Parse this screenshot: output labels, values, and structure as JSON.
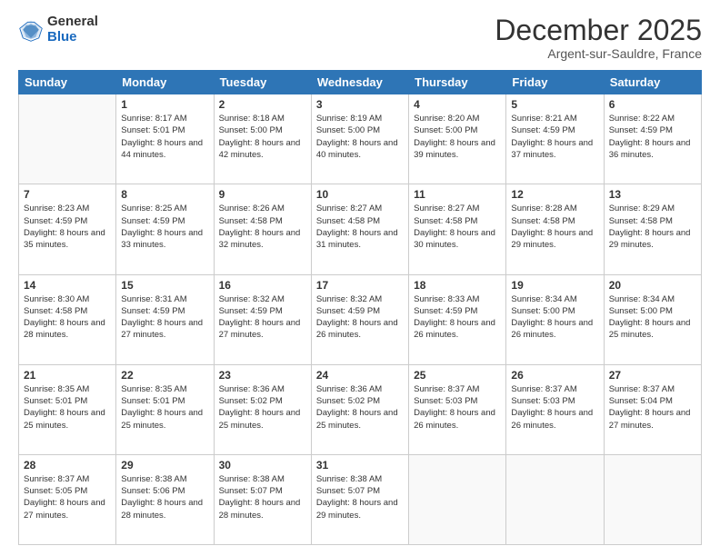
{
  "header": {
    "logo_general": "General",
    "logo_blue": "Blue",
    "month_title": "December 2025",
    "location": "Argent-sur-Sauldre, France"
  },
  "weekdays": [
    "Sunday",
    "Monday",
    "Tuesday",
    "Wednesday",
    "Thursday",
    "Friday",
    "Saturday"
  ],
  "weeks": [
    [
      {
        "day": "",
        "sunrise": "",
        "sunset": "",
        "daylight": ""
      },
      {
        "day": "1",
        "sunrise": "Sunrise: 8:17 AM",
        "sunset": "Sunset: 5:01 PM",
        "daylight": "Daylight: 8 hours and 44 minutes."
      },
      {
        "day": "2",
        "sunrise": "Sunrise: 8:18 AM",
        "sunset": "Sunset: 5:00 PM",
        "daylight": "Daylight: 8 hours and 42 minutes."
      },
      {
        "day": "3",
        "sunrise": "Sunrise: 8:19 AM",
        "sunset": "Sunset: 5:00 PM",
        "daylight": "Daylight: 8 hours and 40 minutes."
      },
      {
        "day": "4",
        "sunrise": "Sunrise: 8:20 AM",
        "sunset": "Sunset: 5:00 PM",
        "daylight": "Daylight: 8 hours and 39 minutes."
      },
      {
        "day": "5",
        "sunrise": "Sunrise: 8:21 AM",
        "sunset": "Sunset: 4:59 PM",
        "daylight": "Daylight: 8 hours and 37 minutes."
      },
      {
        "day": "6",
        "sunrise": "Sunrise: 8:22 AM",
        "sunset": "Sunset: 4:59 PM",
        "daylight": "Daylight: 8 hours and 36 minutes."
      }
    ],
    [
      {
        "day": "7",
        "sunrise": "Sunrise: 8:23 AM",
        "sunset": "Sunset: 4:59 PM",
        "daylight": "Daylight: 8 hours and 35 minutes."
      },
      {
        "day": "8",
        "sunrise": "Sunrise: 8:25 AM",
        "sunset": "Sunset: 4:59 PM",
        "daylight": "Daylight: 8 hours and 33 minutes."
      },
      {
        "day": "9",
        "sunrise": "Sunrise: 8:26 AM",
        "sunset": "Sunset: 4:58 PM",
        "daylight": "Daylight: 8 hours and 32 minutes."
      },
      {
        "day": "10",
        "sunrise": "Sunrise: 8:27 AM",
        "sunset": "Sunset: 4:58 PM",
        "daylight": "Daylight: 8 hours and 31 minutes."
      },
      {
        "day": "11",
        "sunrise": "Sunrise: 8:27 AM",
        "sunset": "Sunset: 4:58 PM",
        "daylight": "Daylight: 8 hours and 30 minutes."
      },
      {
        "day": "12",
        "sunrise": "Sunrise: 8:28 AM",
        "sunset": "Sunset: 4:58 PM",
        "daylight": "Daylight: 8 hours and 29 minutes."
      },
      {
        "day": "13",
        "sunrise": "Sunrise: 8:29 AM",
        "sunset": "Sunset: 4:58 PM",
        "daylight": "Daylight: 8 hours and 29 minutes."
      }
    ],
    [
      {
        "day": "14",
        "sunrise": "Sunrise: 8:30 AM",
        "sunset": "Sunset: 4:58 PM",
        "daylight": "Daylight: 8 hours and 28 minutes."
      },
      {
        "day": "15",
        "sunrise": "Sunrise: 8:31 AM",
        "sunset": "Sunset: 4:59 PM",
        "daylight": "Daylight: 8 hours and 27 minutes."
      },
      {
        "day": "16",
        "sunrise": "Sunrise: 8:32 AM",
        "sunset": "Sunset: 4:59 PM",
        "daylight": "Daylight: 8 hours and 27 minutes."
      },
      {
        "day": "17",
        "sunrise": "Sunrise: 8:32 AM",
        "sunset": "Sunset: 4:59 PM",
        "daylight": "Daylight: 8 hours and 26 minutes."
      },
      {
        "day": "18",
        "sunrise": "Sunrise: 8:33 AM",
        "sunset": "Sunset: 4:59 PM",
        "daylight": "Daylight: 8 hours and 26 minutes."
      },
      {
        "day": "19",
        "sunrise": "Sunrise: 8:34 AM",
        "sunset": "Sunset: 5:00 PM",
        "daylight": "Daylight: 8 hours and 26 minutes."
      },
      {
        "day": "20",
        "sunrise": "Sunrise: 8:34 AM",
        "sunset": "Sunset: 5:00 PM",
        "daylight": "Daylight: 8 hours and 25 minutes."
      }
    ],
    [
      {
        "day": "21",
        "sunrise": "Sunrise: 8:35 AM",
        "sunset": "Sunset: 5:01 PM",
        "daylight": "Daylight: 8 hours and 25 minutes."
      },
      {
        "day": "22",
        "sunrise": "Sunrise: 8:35 AM",
        "sunset": "Sunset: 5:01 PM",
        "daylight": "Daylight: 8 hours and 25 minutes."
      },
      {
        "day": "23",
        "sunrise": "Sunrise: 8:36 AM",
        "sunset": "Sunset: 5:02 PM",
        "daylight": "Daylight: 8 hours and 25 minutes."
      },
      {
        "day": "24",
        "sunrise": "Sunrise: 8:36 AM",
        "sunset": "Sunset: 5:02 PM",
        "daylight": "Daylight: 8 hours and 25 minutes."
      },
      {
        "day": "25",
        "sunrise": "Sunrise: 8:37 AM",
        "sunset": "Sunset: 5:03 PM",
        "daylight": "Daylight: 8 hours and 26 minutes."
      },
      {
        "day": "26",
        "sunrise": "Sunrise: 8:37 AM",
        "sunset": "Sunset: 5:03 PM",
        "daylight": "Daylight: 8 hours and 26 minutes."
      },
      {
        "day": "27",
        "sunrise": "Sunrise: 8:37 AM",
        "sunset": "Sunset: 5:04 PM",
        "daylight": "Daylight: 8 hours and 27 minutes."
      }
    ],
    [
      {
        "day": "28",
        "sunrise": "Sunrise: 8:37 AM",
        "sunset": "Sunset: 5:05 PM",
        "daylight": "Daylight: 8 hours and 27 minutes."
      },
      {
        "day": "29",
        "sunrise": "Sunrise: 8:38 AM",
        "sunset": "Sunset: 5:06 PM",
        "daylight": "Daylight: 8 hours and 28 minutes."
      },
      {
        "day": "30",
        "sunrise": "Sunrise: 8:38 AM",
        "sunset": "Sunset: 5:07 PM",
        "daylight": "Daylight: 8 hours and 28 minutes."
      },
      {
        "day": "31",
        "sunrise": "Sunrise: 8:38 AM",
        "sunset": "Sunset: 5:07 PM",
        "daylight": "Daylight: 8 hours and 29 minutes."
      },
      {
        "day": "",
        "sunrise": "",
        "sunset": "",
        "daylight": ""
      },
      {
        "day": "",
        "sunrise": "",
        "sunset": "",
        "daylight": ""
      },
      {
        "day": "",
        "sunrise": "",
        "sunset": "",
        "daylight": ""
      }
    ]
  ]
}
